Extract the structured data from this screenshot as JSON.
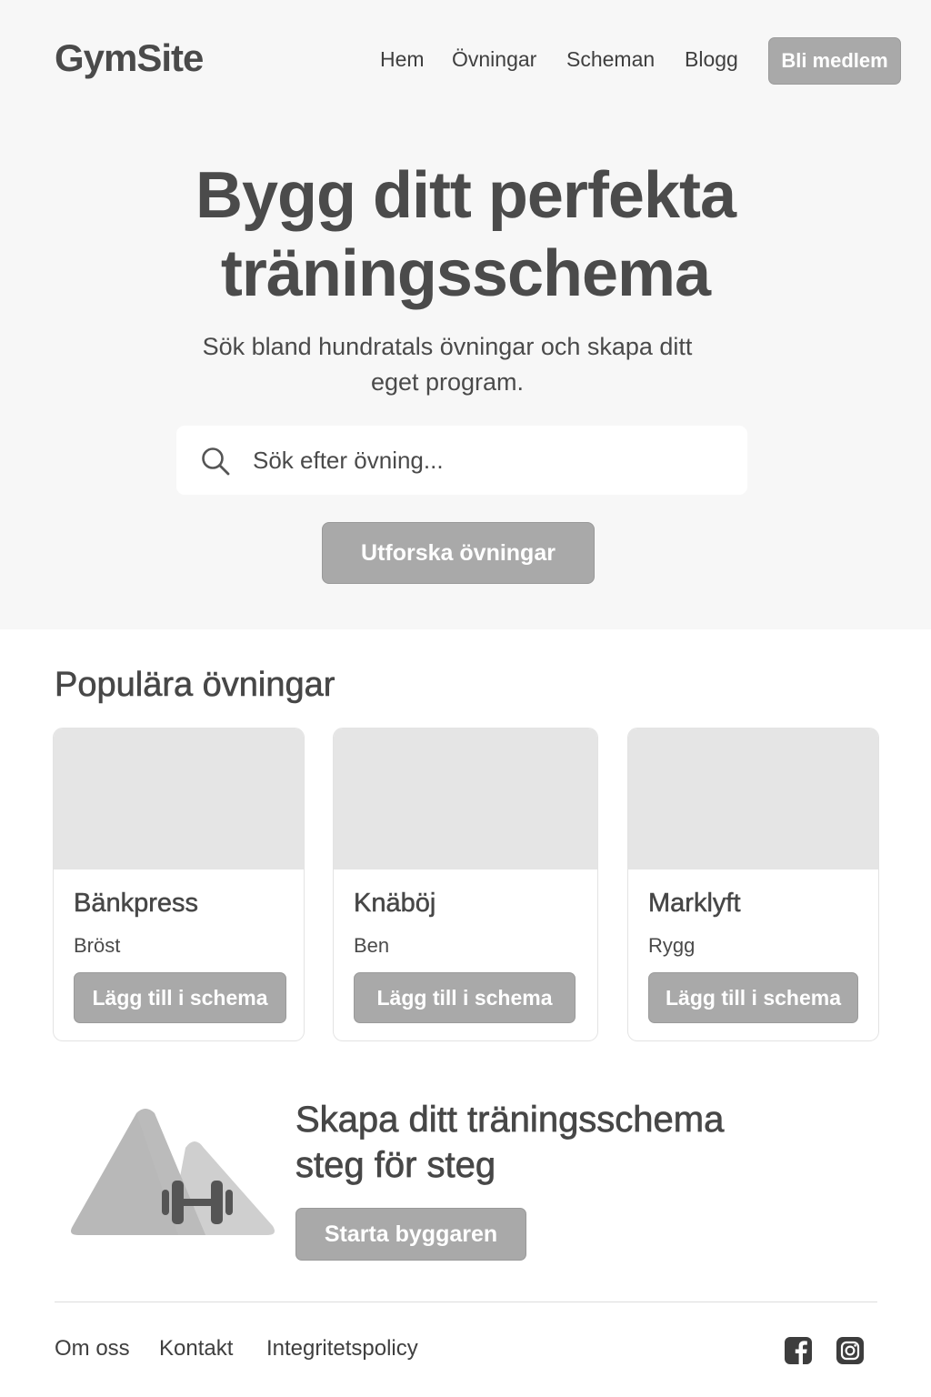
{
  "header": {
    "logo": "GymSite",
    "nav": [
      "Hem",
      "Övningar",
      "Scheman",
      "Blogg"
    ],
    "cta_label": "Bli medlem"
  },
  "hero": {
    "title_line1": "Bygg ditt perfekta",
    "title_line2": "träningsschema",
    "subtitle_line1": "Sök bland hundratals övningar och skapa ditt",
    "subtitle_line2": "eget program.",
    "search_placeholder": "Sök efter övning...",
    "search_icon": "search-icon",
    "explore_label": "Utforska övningar"
  },
  "popular": {
    "title": "Populära övningar",
    "exercises": [
      {
        "name": "Bänkpress",
        "category": "Bröst",
        "button": "Lägg till i schema"
      },
      {
        "name": "Knäböj",
        "category": "Ben",
        "button": "Lägg till i schema"
      },
      {
        "name": "Marklyft",
        "category": "Rygg",
        "button": "Lägg till i schema"
      }
    ]
  },
  "builder": {
    "title_line1": "Skapa ditt träningsschema",
    "title_line2": "steg för steg",
    "button": "Starta byggaren",
    "illustration": "mountain-dumbbell-illustration"
  },
  "footer": {
    "links": [
      "Om oss",
      "Kontakt",
      "Integritetspolicy"
    ],
    "social_icons": [
      "facebook-icon",
      "instagram-icon"
    ]
  },
  "colors": {
    "hero_background": "#f7f7f7",
    "button": "#a9a9a9",
    "text": "#4a4a4a",
    "card_image": "#e5e5e5"
  }
}
